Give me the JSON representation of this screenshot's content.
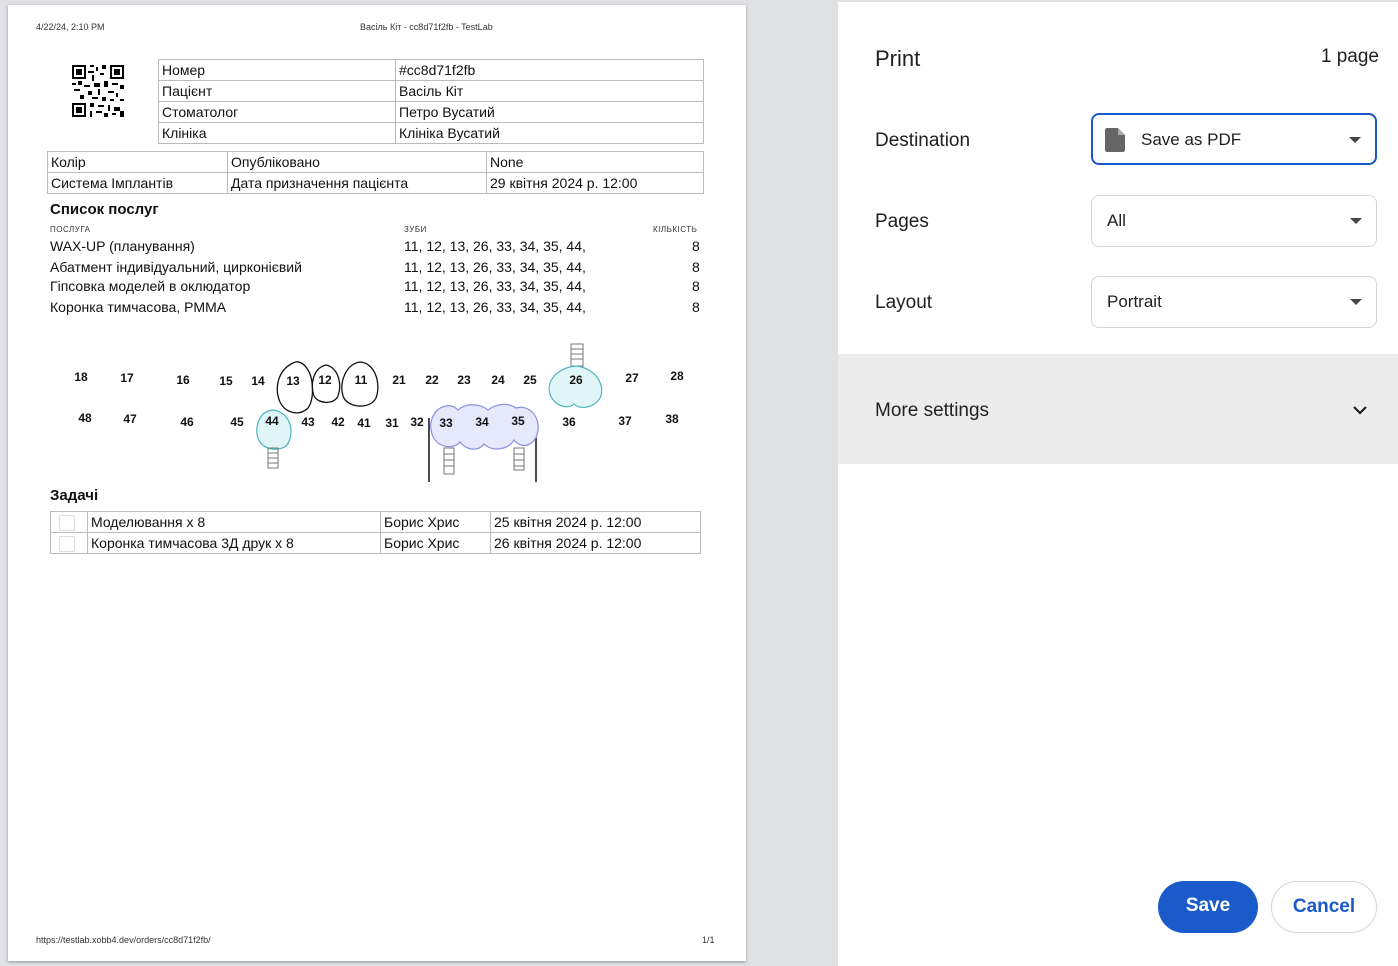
{
  "doc": {
    "header_date": "4/22/24, 2:10 PM",
    "header_title": "Васіль Кіт - cc8d71f2fb - TestLab",
    "footer_url": "https://testlab.xobb4.dev/orders/cc8d71f2fb/",
    "footer_page": "1/1",
    "info": [
      {
        "label": "Номер",
        "value": "#cc8d71f2fb"
      },
      {
        "label": "Пацієнт",
        "value": "Васіль Кіт"
      },
      {
        "label": "Стоматолог",
        "value": "Петро Вусатий"
      },
      {
        "label": "Клініка",
        "value": "Клініка Вусатий"
      }
    ],
    "meta": [
      {
        "a": "Колір",
        "b": "Опубліковано",
        "c": "None"
      },
      {
        "a": "Система Імплантів",
        "b": "Дата призначення пацієнта",
        "c": "29 квітня 2024 р. 12:00"
      }
    ],
    "services_title": "Список послуг",
    "services_headers": {
      "service": "ПОСЛУГА",
      "teeth": "ЗУБИ",
      "qty": "КІЛЬКІСТЬ"
    },
    "services": [
      {
        "name": "WAX-UP (планування)",
        "teeth": "11, 12, 13, 26, 33, 34, 35, 44,",
        "qty": "8"
      },
      {
        "name": "Абатмент індивідуальний, цирконієвий",
        "teeth": "11, 12, 13, 26, 33, 34, 35, 44,",
        "qty": "8"
      },
      {
        "name": "Гіпсовка моделей в оклюдатор",
        "teeth": "11, 12, 13, 26, 33, 34, 35, 44,",
        "qty": "8"
      },
      {
        "name": "Коронка тимчасова, PMMA",
        "teeth": "11, 12, 13, 26, 33, 34, 35, 44,",
        "qty": "8"
      }
    ],
    "upper_teeth": [
      "18",
      "17",
      "16",
      "15",
      "14",
      "13",
      "12",
      "11",
      "21",
      "22",
      "23",
      "24",
      "25",
      "26",
      "27",
      "28"
    ],
    "lower_teeth": [
      "48",
      "47",
      "46",
      "45",
      "44",
      "43",
      "42",
      "41",
      "31",
      "32",
      "33",
      "34",
      "35",
      "36",
      "37",
      "38"
    ],
    "tasks_title": "Задачі",
    "tasks": [
      {
        "name": "Моделювання x 8",
        "person": "Борис Хрис",
        "date": "25 квітня 2024 р. 12:00"
      },
      {
        "name": "Коронка тимчасова 3Д друк x 8",
        "person": "Борис Хрис",
        "date": "26 квітня 2024 р. 12:00"
      }
    ]
  },
  "panel": {
    "title": "Print",
    "pages_count": "1 page",
    "destination_label": "Destination",
    "destination_value": "Save as PDF",
    "pages_label": "Pages",
    "pages_value": "All",
    "layout_label": "Layout",
    "layout_value": "Portrait",
    "more_settings": "More settings",
    "save": "Save",
    "cancel": "Cancel"
  },
  "colors": {
    "accent": "#1a5ac9",
    "implant_fill": "#e0f5f7",
    "bridge_fill": "#e6e8fb"
  }
}
